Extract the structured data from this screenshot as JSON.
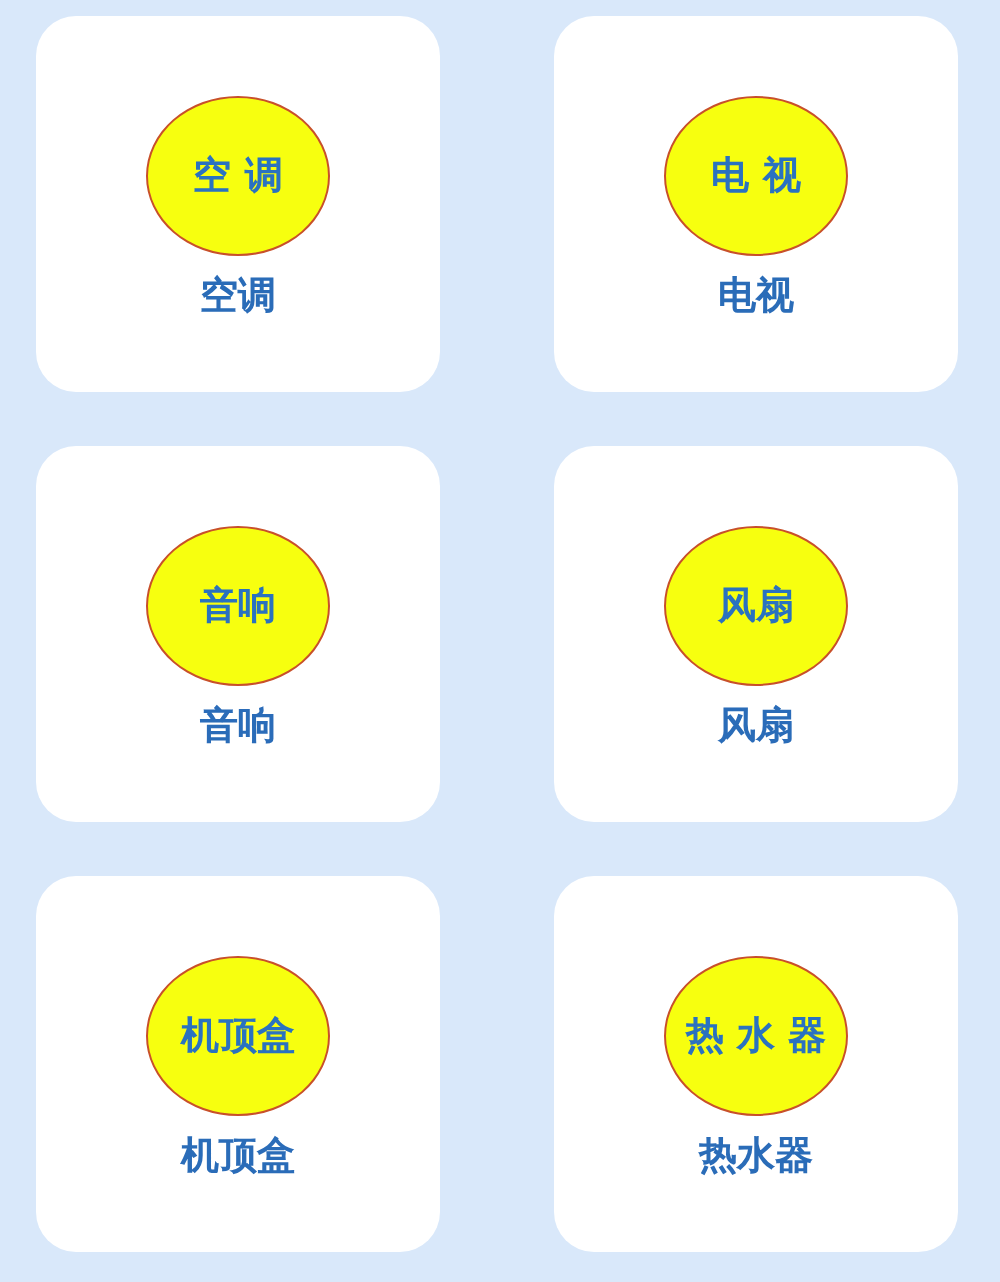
{
  "devices": [
    {
      "badge": "空 调",
      "label": "空调"
    },
    {
      "badge": "电 视",
      "label": "电视"
    },
    {
      "badge": "音响",
      "label": "音响"
    },
    {
      "badge": "风扇",
      "label": "风扇"
    },
    {
      "badge": "机顶盒",
      "label": "机顶盒"
    },
    {
      "badge": "热 水 器",
      "label": "热水器"
    }
  ]
}
